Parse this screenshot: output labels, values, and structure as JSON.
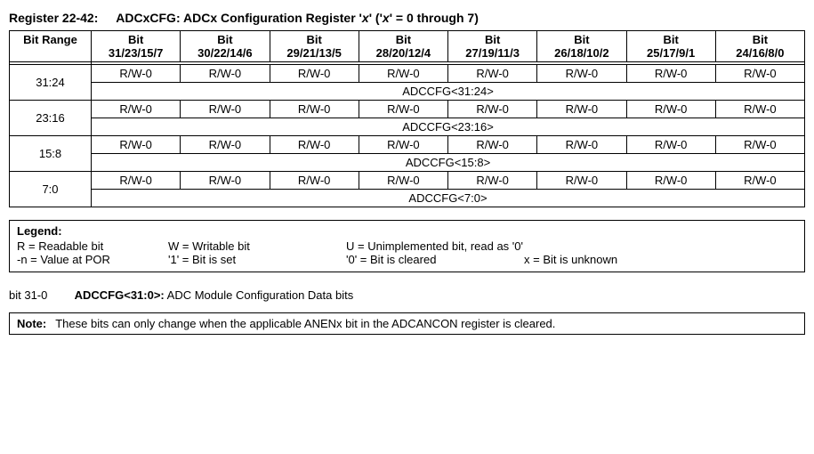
{
  "title": {
    "reg_number": "Register 22-42:",
    "name": "ADCxCFG: ADCx Configuration Register '",
    "x1": "x",
    "paren1": "' ('",
    "x2": "x",
    "paren2": "' = 0 through 7)"
  },
  "header": {
    "bit_range": "Bit Range",
    "cols": [
      {
        "top": "Bit",
        "bottom": "31/23/15/7"
      },
      {
        "top": "Bit",
        "bottom": "30/22/14/6"
      },
      {
        "top": "Bit",
        "bottom": "29/21/13/5"
      },
      {
        "top": "Bit",
        "bottom": "28/20/12/4"
      },
      {
        "top": "Bit",
        "bottom": "27/19/11/3"
      },
      {
        "top": "Bit",
        "bottom": "26/18/10/2"
      },
      {
        "top": "Bit",
        "bottom": "25/17/9/1"
      },
      {
        "top": "Bit",
        "bottom": "24/16/8/0"
      }
    ]
  },
  "rows": [
    {
      "range": "31:24",
      "rw": [
        "R/W-0",
        "R/W-0",
        "R/W-0",
        "R/W-0",
        "R/W-0",
        "R/W-0",
        "R/W-0",
        "R/W-0"
      ],
      "field": "ADCCFG<31:24>"
    },
    {
      "range": "23:16",
      "rw": [
        "R/W-0",
        "R/W-0",
        "R/W-0",
        "R/W-0",
        "R/W-0",
        "R/W-0",
        "R/W-0",
        "R/W-0"
      ],
      "field": "ADCCFG<23:16>"
    },
    {
      "range": "15:8",
      "rw": [
        "R/W-0",
        "R/W-0",
        "R/W-0",
        "R/W-0",
        "R/W-0",
        "R/W-0",
        "R/W-0",
        "R/W-0"
      ],
      "field": "ADCCFG<15:8>"
    },
    {
      "range": "7:0",
      "rw": [
        "R/W-0",
        "R/W-0",
        "R/W-0",
        "R/W-0",
        "R/W-0",
        "R/W-0",
        "R/W-0",
        "R/W-0"
      ],
      "field": "ADCCFG<7:0>"
    }
  ],
  "legend": {
    "title": "Legend:",
    "row1": {
      "c1": "R = Readable bit",
      "c2": "W = Writable bit",
      "c3": "U = Unimplemented bit, read as '0'"
    },
    "row2": {
      "c1": "-n = Value at POR",
      "c2": "'1' = Bit is set",
      "c3": "'0' = Bit is cleared",
      "c4": "x = Bit is unknown"
    }
  },
  "bitdesc": {
    "range": "bit 31-0",
    "name": "ADCCFG<31:0>:",
    "text": " ADC Module Configuration Data bits"
  },
  "note": {
    "label": "Note:",
    "text": "These bits can only change when the applicable ANENx bit in the ADCANCON register is cleared."
  }
}
